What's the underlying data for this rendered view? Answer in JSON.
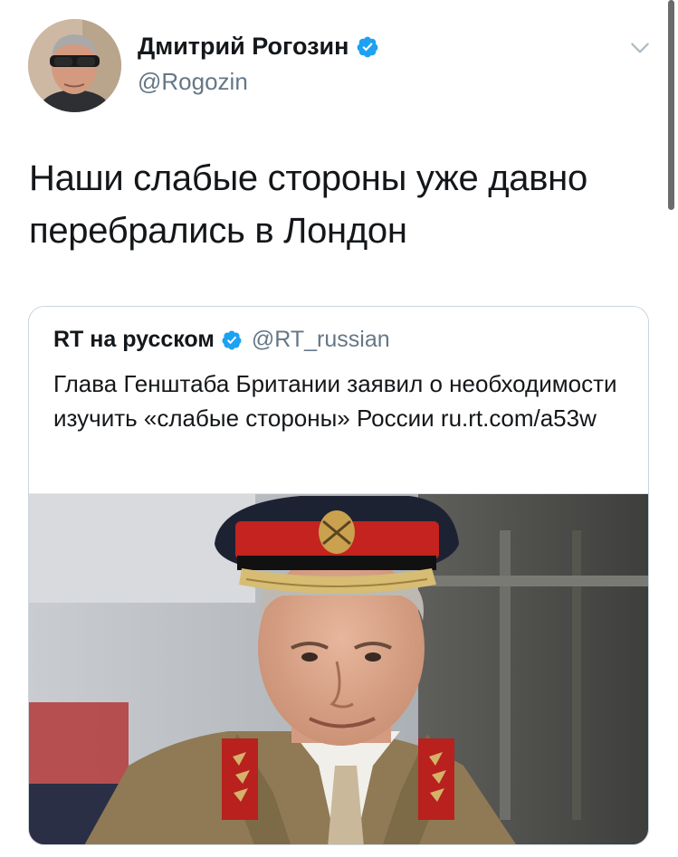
{
  "tweet": {
    "author_name": "Дмитрий Рогозин",
    "author_handle": "@Rogozin",
    "text": "Наши слабые стороны уже давно перебрались в Лондон",
    "icons": {
      "avatar": "avatar-photo",
      "verified": "verified-badge-icon",
      "menu": "chevron-down-icon"
    },
    "colors": {
      "verified": "#1da1f2",
      "secondary_text": "#657786",
      "primary_text": "#14171a",
      "card_border": "#ccd6dd"
    }
  },
  "quoted_tweet": {
    "author_name": "RT на русском",
    "author_handle": "@RT_russian",
    "text_part1": "Глава Генштаба Британии заявил о необходимости изучить «слабые стороны» России ",
    "link": "ru.rt.com/a53w",
    "media": "photo-military-officer-in-peaked-cap"
  }
}
